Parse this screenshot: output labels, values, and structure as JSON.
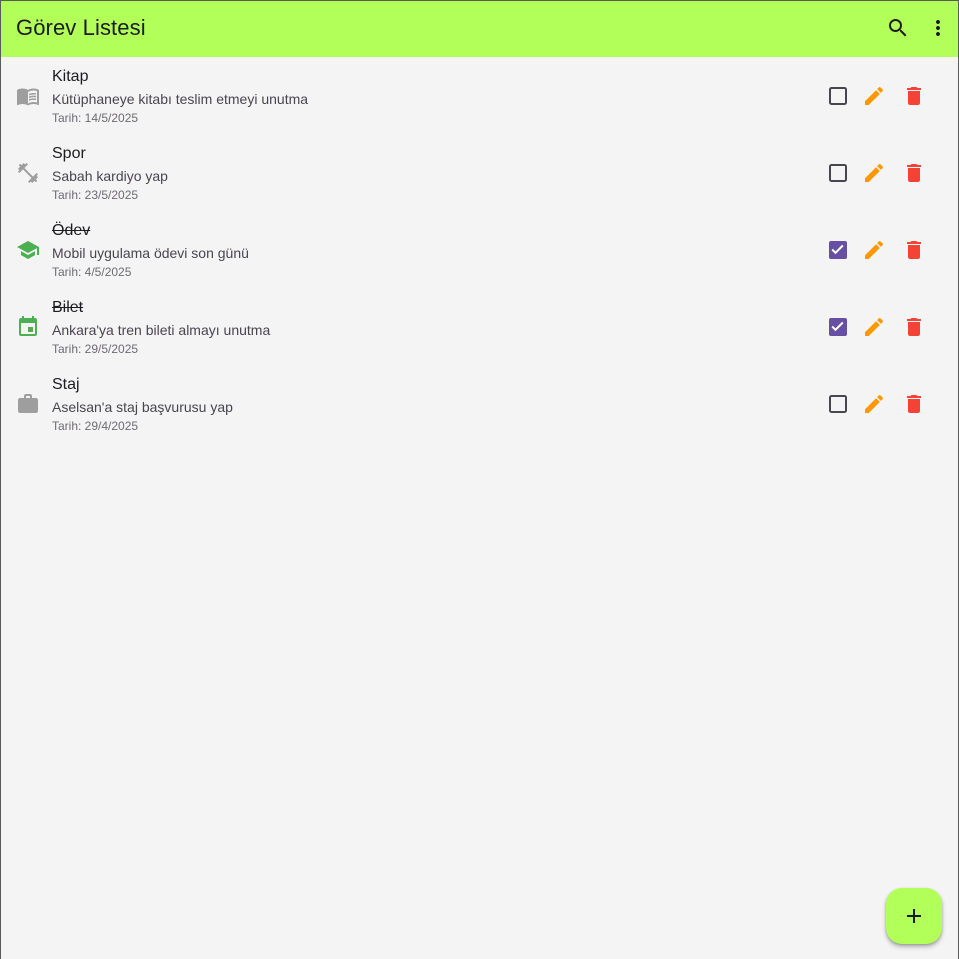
{
  "appbar": {
    "title": "Görev Listesi",
    "background": "#b2ff59",
    "actions": [
      {
        "name": "search-icon"
      },
      {
        "name": "more-vert-icon"
      }
    ]
  },
  "tasks": [
    {
      "title": "Kitap",
      "description": "Kütüphaneye kitabı teslim etmeyi unutma",
      "date": "Tarih: 14/5/2025",
      "done": false,
      "icon": "book-icon",
      "icon_color": "#9e9e9e"
    },
    {
      "title": "Spor",
      "description": "Sabah kardiyo yap",
      "date": "Tarih: 23/5/2025",
      "done": false,
      "icon": "dumbbell-icon",
      "icon_color": "#9e9e9e"
    },
    {
      "title": "Ödev",
      "description": "Mobil uygulama ödevi son günü",
      "date": "Tarih: 4/5/2025",
      "done": true,
      "icon": "school-icon",
      "icon_color": "#4caf50"
    },
    {
      "title": "Bilet",
      "description": "Ankara'ya tren bileti almayı unutma",
      "date": "Tarih: 29/5/2025",
      "done": true,
      "icon": "calendar-icon",
      "icon_color": "#4caf50"
    },
    {
      "title": "Staj",
      "description": "Aselsan'a staj başvurusu yap",
      "date": "Tarih: 29/4/2025",
      "done": false,
      "icon": "briefcase-icon",
      "icon_color": "#9e9e9e"
    }
  ],
  "colors": {
    "checkbox_checked": "#6750a4",
    "checkbox_unchecked": "#49454f",
    "edit": "#ff9800",
    "delete": "#f44336",
    "fab": "#b2ff59"
  },
  "fab": {
    "icon": "add-icon"
  }
}
